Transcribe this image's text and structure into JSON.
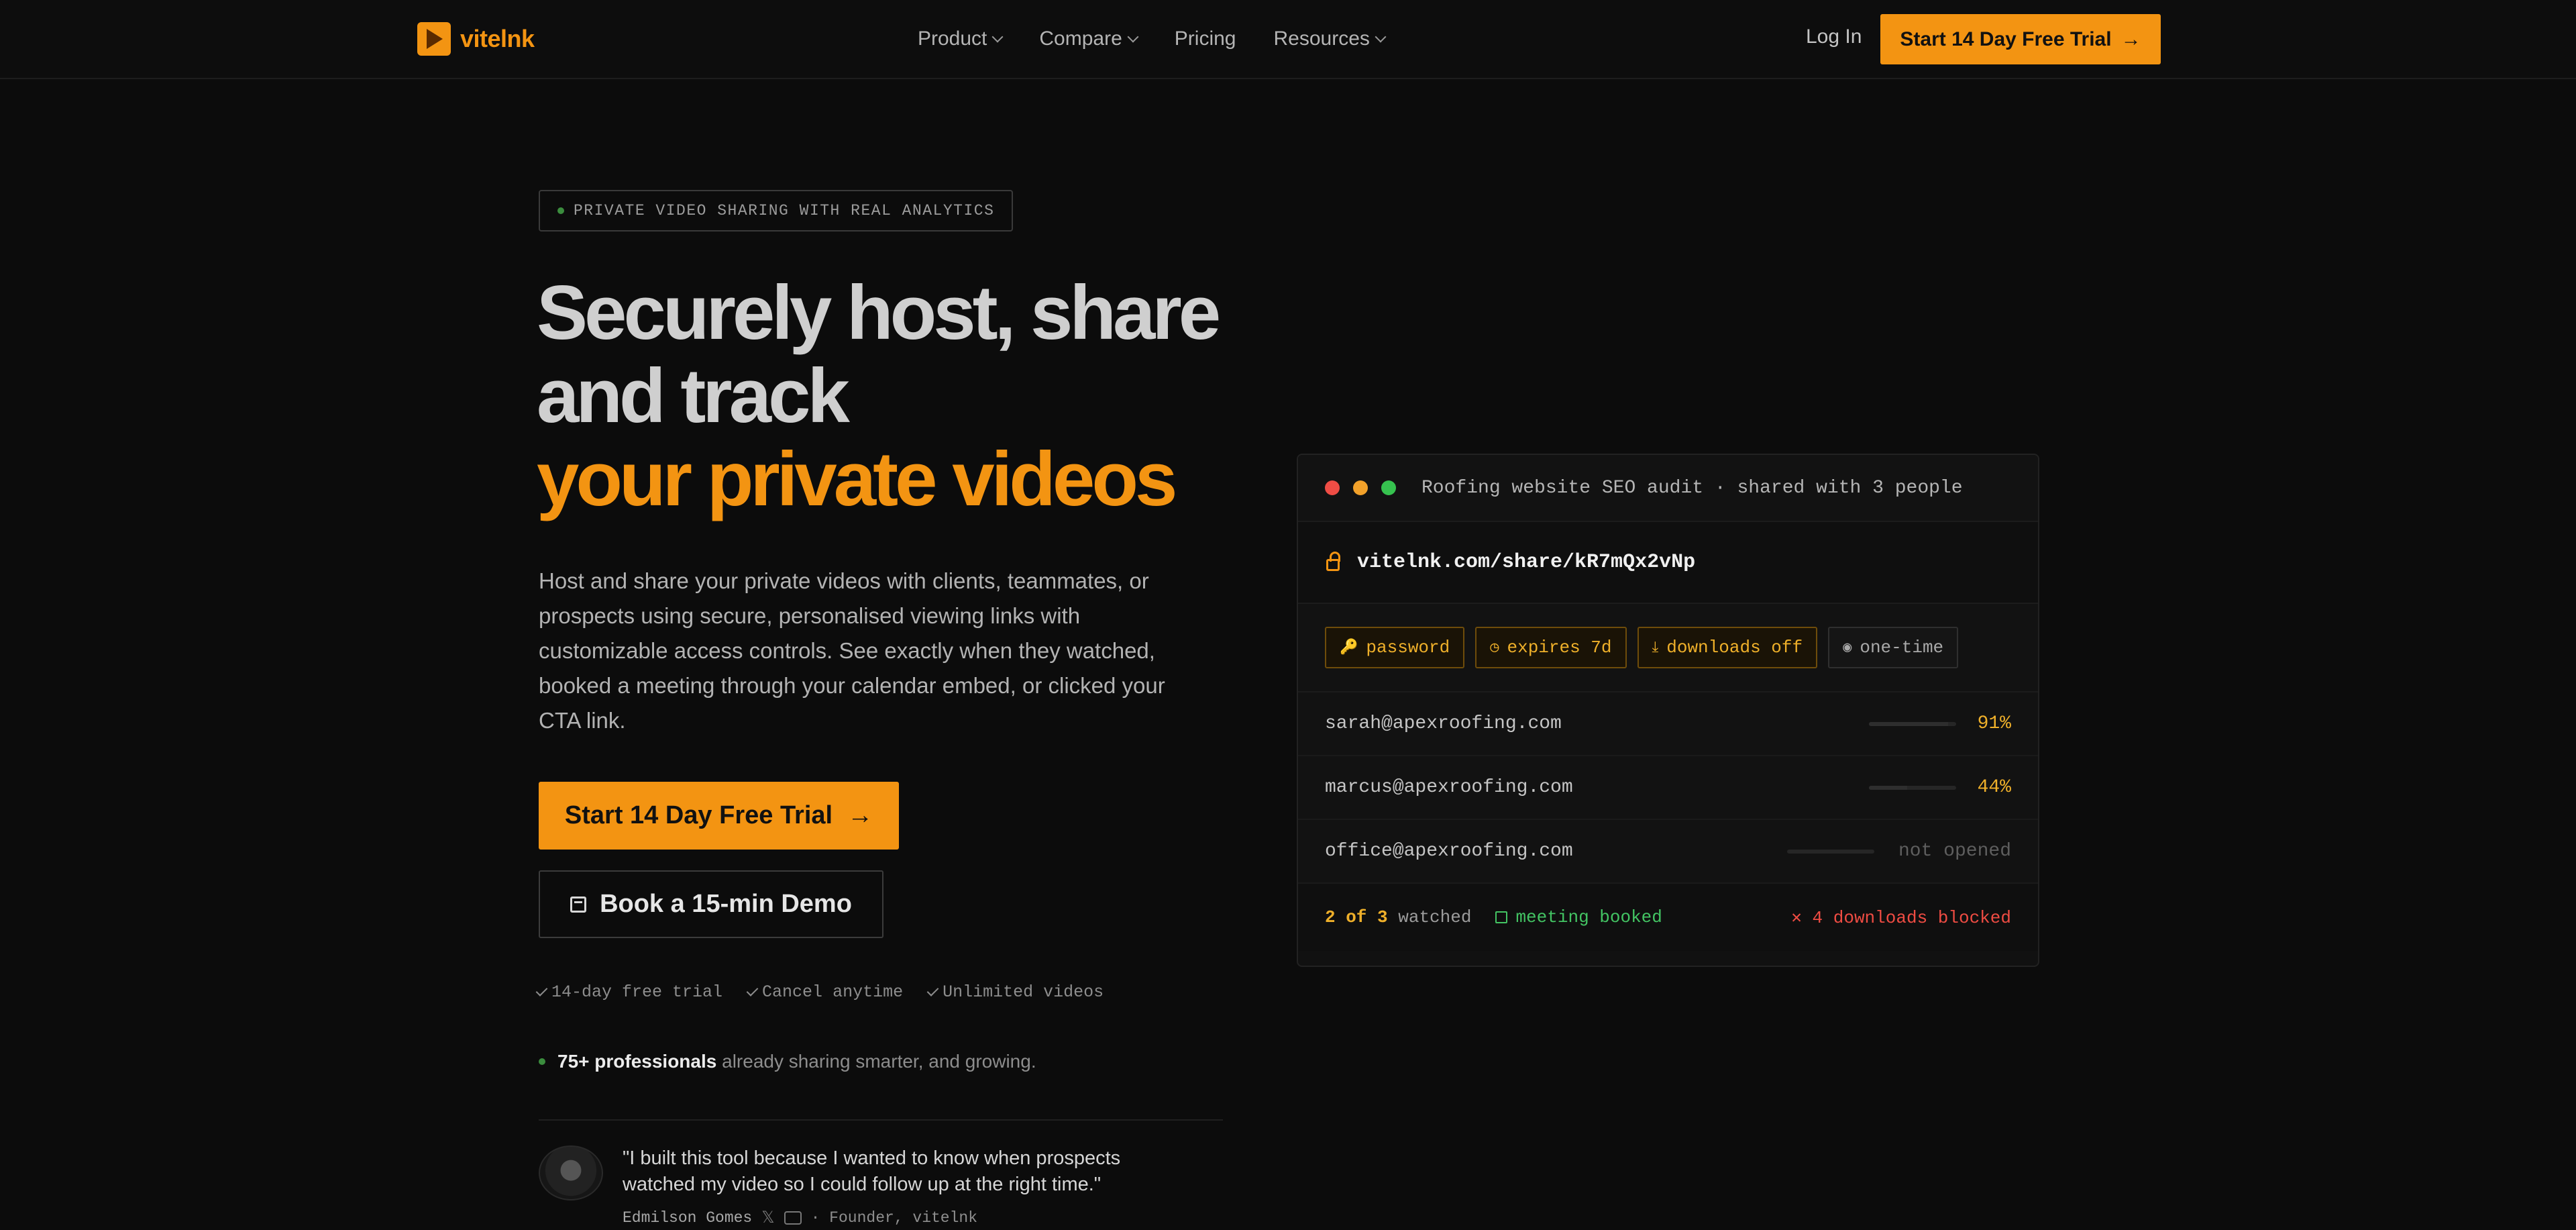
{
  "nav": {
    "logo_text": "vitelnk",
    "links": [
      "Product",
      "Compare",
      "Pricing",
      "Resources"
    ],
    "login": "Log In",
    "cta": "Start 14 Day Free Trial",
    "cta_arrow": "→"
  },
  "hero": {
    "badge": "PRIVATE VIDEO SHARING WITH REAL ANALYTICS",
    "title_line1": "Securely host, share",
    "title_line2": "and track",
    "title_accent": "your private videos",
    "lead": "Host and share your private videos with clients, teammates, or prospects using secure, personalised viewing links with customizable access controls. See exactly when they watched, booked a meeting through your calendar embed, or clicked your CTA link.",
    "cta_primary": "Start 14 Day Free Trial",
    "cta_primary_arrow": "→",
    "cta_secondary": "Book a 15-min Demo",
    "checks": [
      "14-day free trial",
      "Cancel anytime",
      "Unlimited videos"
    ],
    "social_bold": "75+ professionals",
    "social_rest": "already sharing smarter, and growing.",
    "quote": "\"I built this tool because I wanted to know when prospects watched my video so I could follow up at the right time.\"",
    "author_name": "Edmilson Gomes",
    "author_x": "𝕏",
    "author_role": "· Founder, vitelnk"
  },
  "card": {
    "title": "Roofing website SEO audit · shared with 3 people",
    "url": "vitelnk.com/share/kR7mQx2vNp",
    "tags": [
      {
        "icon": "🔑",
        "label": "password"
      },
      {
        "icon": "◷",
        "label": "expires 7d"
      },
      {
        "icon": "⤓",
        "label": "downloads off"
      },
      {
        "icon": "◉",
        "label": "one-time"
      }
    ],
    "viewers": [
      {
        "email": "sarah@apexroofing.com",
        "status": "91%",
        "progress": 0.91
      },
      {
        "email": "marcus@apexroofing.com",
        "status": "44%",
        "progress": 0.44
      },
      {
        "email": "office@apexroofing.com",
        "status": "not opened",
        "progress": 0
      }
    ],
    "watched_count": "2 of 3",
    "watched_label": "watched",
    "meeting": "meeting booked",
    "blocked": "✕ 4 downloads blocked"
  },
  "colors": {
    "accent": "#f39412",
    "success": "#43c463",
    "danger": "#ef4c43",
    "traffic_lights": [
      "#ef4d45",
      "#f2a12a",
      "#36c24f"
    ]
  }
}
